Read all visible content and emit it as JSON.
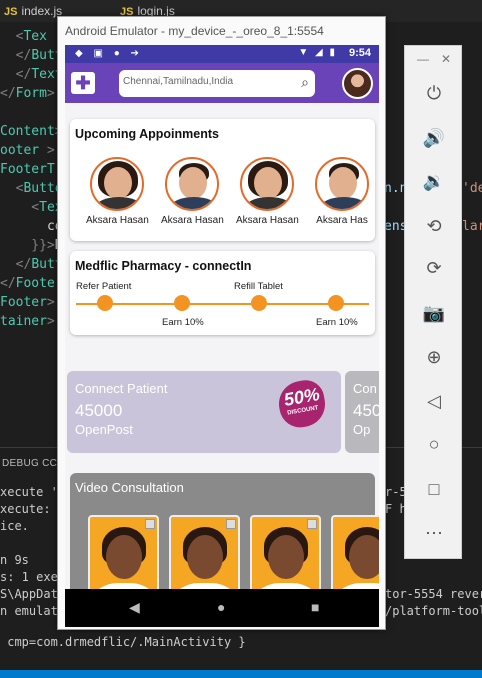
{
  "editor": {
    "tabs": [
      {
        "icon": "JS",
        "label": "index.js"
      },
      {
        "icon": "JS",
        "label": "login.js"
      }
    ],
    "code_lines": [
      {
        "parts": [
          [
            "pun",
            "  <"
          ],
          [
            "tagc",
            "Tex"
          ]
        ]
      },
      {
        "parts": [
          [
            "pun",
            "  </"
          ],
          [
            "tagc",
            "Butt"
          ]
        ]
      },
      {
        "parts": [
          [
            "pun",
            "  </"
          ],
          [
            "tagc",
            "Text"
          ],
          [
            "pun",
            ">"
          ]
        ]
      },
      {
        "parts": [
          [
            "pun",
            "</"
          ],
          [
            "tagc",
            "Form"
          ],
          [
            "pun",
            ">"
          ]
        ]
      },
      {
        "parts": [
          [
            "txt",
            " "
          ]
        ]
      },
      {
        "parts": [
          [
            "tagc",
            "Content"
          ],
          [
            "pun",
            ">"
          ]
        ]
      },
      {
        "parts": [
          [
            "tagc",
            "ooter"
          ],
          [
            "pun",
            " >"
          ]
        ]
      },
      {
        "parts": [
          [
            "tagc",
            "FooterT"
          ]
        ]
      },
      {
        "parts": [
          [
            "pun",
            "  <"
          ],
          [
            "tagc",
            "Butto"
          ]
        ]
      },
      {
        "parts": [
          [
            "pun",
            "    <"
          ],
          [
            "tagc",
            "Tex"
          ]
        ]
      },
      {
        "parts": [
          [
            "txt",
            "      co"
          ]
        ]
      },
      {
        "parts": [
          [
            "pun",
            "    }}>"
          ],
          [
            "txt",
            "D"
          ]
        ]
      },
      {
        "parts": [
          [
            "pun",
            "  </"
          ],
          [
            "tagc",
            "Butt"
          ]
        ]
      },
      {
        "parts": [
          [
            "pun",
            "</"
          ],
          [
            "tagc",
            "Footer"
          ]
        ]
      },
      {
        "parts": [
          [
            "tagc",
            "Footer"
          ],
          [
            "pun",
            ">"
          ]
        ]
      },
      {
        "parts": [
          [
            "tagc",
            "tainer"
          ],
          [
            "pun",
            ">"
          ]
        ]
      }
    ],
    "right_code": [
      {
        "text": "n.n",
        "cls": "att"
      },
      {
        "text": "'de",
        "cls": "str"
      },
      {
        "text": "ens",
        "cls": "att"
      },
      {
        "text": "lar",
        "cls": "str"
      }
    ],
    "debug_tab": "DEBUG CC",
    "debug_lines_left": [
      "xecute 'r",
      "xecute: r",
      "ice.",
      "",
      "n 9s",
      "s: 1 exec",
      "S\\AppDat",
      "n emulato"
    ],
    "debug_lines_right": [
      "r-5",
      "F h",
      "",
      "",
      "",
      "",
      "tor-5554 rever",
      "/platform-tools"
    ],
    "bottom_line": " cmp=com.drmedflic/.MainActivity }"
  },
  "emulator": {
    "title": "Android Emulator - my_device_-_oreo_8_1:5554",
    "status": {
      "time": "9:54",
      "left_icons": "◆ ▣ ● ➔",
      "right_icons": "▼ ◢ ▮"
    },
    "header": {
      "kit_icon": "medical-kit-icon",
      "search_value": "Chennai,Tamilnadu,India",
      "search_icon": "⌕"
    },
    "appointments": {
      "title": "Upcoming Appoinments",
      "doctors": [
        {
          "name": "Aksara Hasan",
          "gender": "female"
        },
        {
          "name": "Aksara Hasan",
          "gender": "male"
        },
        {
          "name": "Aksara Hasan",
          "gender": "female"
        },
        {
          "name": "Aksara Has",
          "gender": "male"
        }
      ]
    },
    "pharmacy": {
      "title": "Medflic Pharmacy - connectIn",
      "labels_top": [
        "Refer Patient",
        "Refill Tablet"
      ],
      "labels_bottom": [
        "Earn 10%",
        "Earn 10%"
      ]
    },
    "promos": [
      {
        "line1": "Connect Patient",
        "line2": "45000",
        "line3": "OpenPost",
        "badge_big": "50%",
        "badge_small": "DISCOUNT"
      },
      {
        "line1": "Con",
        "line2": "450",
        "line3": "Op"
      }
    ],
    "video": {
      "title": "Video Consultation"
    },
    "nav": {
      "back": "◀",
      "home": "●",
      "recents": "■"
    }
  },
  "panel": {
    "minimize": "—",
    "close": "✕",
    "buttons": [
      {
        "name": "power-icon",
        "glyph": "⏻"
      },
      {
        "name": "volume-up-icon",
        "glyph": "🔊"
      },
      {
        "name": "volume-down-icon",
        "glyph": "🔉"
      },
      {
        "name": "rotate-left-icon",
        "glyph": "⟲"
      },
      {
        "name": "rotate-right-icon",
        "glyph": "⟳"
      },
      {
        "name": "camera-icon",
        "glyph": "📷"
      },
      {
        "name": "zoom-icon",
        "glyph": "⊕"
      },
      {
        "name": "back-icon",
        "glyph": "◁"
      },
      {
        "name": "home-icon",
        "glyph": "○"
      },
      {
        "name": "overview-icon",
        "glyph": "□"
      },
      {
        "name": "more-icon",
        "glyph": "⋯"
      }
    ]
  }
}
